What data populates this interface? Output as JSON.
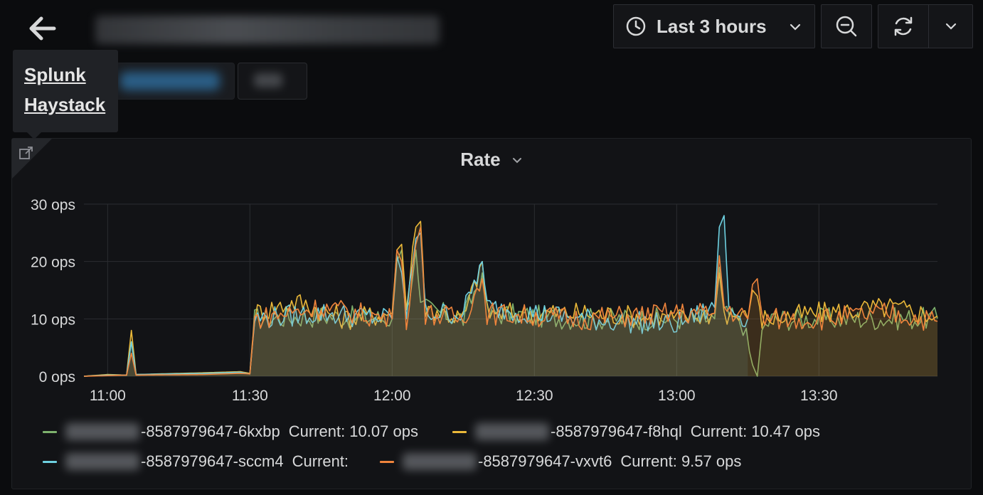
{
  "header": {
    "back_icon": "arrow-left-icon",
    "time_range_label": "Last 3 hours",
    "time_icon": "clock-icon",
    "zoom_icon": "zoom-out-icon",
    "refresh_icon": "refresh-icon",
    "refresh_dropdown_icon": "chevron-down-icon"
  },
  "tooltip": {
    "links": [
      "Splunk",
      "Haystack"
    ]
  },
  "panel": {
    "title": "Rate",
    "link_icon": "external-link-icon"
  },
  "colors": {
    "background": "#0b0c0e",
    "panel": "#121316",
    "grid": "#2b2d31",
    "fill": "#4a4035"
  },
  "chart_data": {
    "type": "line",
    "title": "Rate",
    "yunit": "ops",
    "ylim": [
      0,
      30
    ],
    "yticks": [
      "0 ops",
      "10 ops",
      "20 ops",
      "30 ops"
    ],
    "xticks": [
      "11:00",
      "11:30",
      "12:00",
      "12:30",
      "13:00",
      "13:30"
    ],
    "xrange": [
      "10:55",
      "13:55"
    ],
    "grid": true,
    "fill": true,
    "legend_placement": "bottom",
    "series": [
      {
        "name": "-8587979647-6kxbp",
        "color": "#7eb26d",
        "current": "Current: 10.07 ops",
        "points": [
          [
            "10:55",
            0
          ],
          [
            "11:00",
            0.2
          ],
          [
            "11:04",
            0.2
          ],
          [
            "11:05",
            6
          ],
          [
            "11:06",
            0.3
          ],
          [
            "11:20",
            0.4
          ],
          [
            "11:28",
            0.5
          ],
          [
            "11:30",
            0.5
          ],
          [
            "11:31",
            10
          ],
          [
            "11:45",
            10.5
          ],
          [
            "12:00",
            10
          ],
          [
            "12:01",
            20
          ],
          [
            "12:02",
            22
          ],
          [
            "12:03",
            11
          ],
          [
            "12:05",
            22
          ],
          [
            "12:06",
            12
          ],
          [
            "12:15",
            10
          ],
          [
            "12:19",
            18
          ],
          [
            "12:20",
            11
          ],
          [
            "12:40",
            10
          ],
          [
            "13:00",
            10
          ],
          [
            "13:08",
            10
          ],
          [
            "13:09",
            19
          ],
          [
            "13:10",
            11
          ],
          [
            "13:14",
            9
          ],
          [
            "13:16",
            2
          ],
          [
            "13:17",
            0
          ],
          [
            "13:18",
            8
          ],
          [
            "13:20",
            10
          ],
          [
            "13:40",
            10
          ],
          [
            "13:55",
            10.07
          ]
        ]
      },
      {
        "name": "-8587979647-f8hql",
        "color": "#eab839",
        "current": "Current: 10.47 ops",
        "points": [
          [
            "10:55",
            0
          ],
          [
            "11:00",
            0.3
          ],
          [
            "11:04",
            0.2
          ],
          [
            "11:05",
            8
          ],
          [
            "11:06",
            0.3
          ],
          [
            "11:20",
            0.6
          ],
          [
            "11:28",
            0.8
          ],
          [
            "11:30",
            0.5
          ],
          [
            "11:31",
            11
          ],
          [
            "11:40",
            13
          ],
          [
            "11:50",
            10
          ],
          [
            "12:00",
            11
          ],
          [
            "12:01",
            22
          ],
          [
            "12:02",
            23
          ],
          [
            "12:03",
            12
          ],
          [
            "12:05",
            26
          ],
          [
            "12:06",
            27
          ],
          [
            "12:07",
            12
          ],
          [
            "12:15",
            10
          ],
          [
            "12:19",
            20
          ],
          [
            "12:20",
            11
          ],
          [
            "12:40",
            11
          ],
          [
            "13:00",
            10
          ],
          [
            "13:08",
            11
          ],
          [
            "13:09",
            18
          ],
          [
            "13:10",
            11
          ],
          [
            "13:15",
            10
          ],
          [
            "13:16",
            15
          ],
          [
            "13:17",
            14
          ],
          [
            "13:18",
            10
          ],
          [
            "13:30",
            11
          ],
          [
            "13:45",
            12
          ],
          [
            "13:55",
            10.47
          ]
        ]
      },
      {
        "name": "-8587979647-sccm4",
        "color": "#6ed0e0",
        "current": "Current:",
        "points": [
          [
            "10:55",
            0
          ],
          [
            "11:00",
            0.2
          ],
          [
            "11:04",
            0.2
          ],
          [
            "11:05",
            6
          ],
          [
            "11:06",
            0.3
          ],
          [
            "11:20",
            0.5
          ],
          [
            "11:28",
            0.7
          ],
          [
            "11:30",
            0.4
          ],
          [
            "11:31",
            10
          ],
          [
            "11:45",
            11
          ],
          [
            "12:00",
            10
          ],
          [
            "12:01",
            21
          ],
          [
            "12:02",
            18
          ],
          [
            "12:03",
            11
          ],
          [
            "12:05",
            24
          ],
          [
            "12:06",
            25
          ],
          [
            "12:07",
            11
          ],
          [
            "12:15",
            11
          ],
          [
            "12:19",
            20
          ],
          [
            "12:20",
            12
          ],
          [
            "12:40",
            10
          ],
          [
            "13:00",
            9
          ],
          [
            "13:08",
            12
          ],
          [
            "13:09",
            26
          ],
          [
            "13:10",
            28
          ],
          [
            "13:11",
            12
          ],
          [
            "13:15",
            10
          ]
        ]
      },
      {
        "name": "-8587979647-vxvt6",
        "color": "#ef843c",
        "current": "Current: 9.57 ops",
        "points": [
          [
            "10:55",
            0
          ],
          [
            "11:00",
            0.1
          ],
          [
            "11:04",
            0.2
          ],
          [
            "11:05",
            4
          ],
          [
            "11:06",
            0.2
          ],
          [
            "11:20",
            0.3
          ],
          [
            "11:28",
            0.5
          ],
          [
            "11:30",
            0.4
          ],
          [
            "11:31",
            10
          ],
          [
            "11:45",
            12
          ],
          [
            "12:00",
            10
          ],
          [
            "12:01",
            22
          ],
          [
            "12:02",
            20
          ],
          [
            "12:03",
            10
          ],
          [
            "12:05",
            23
          ],
          [
            "12:06",
            26
          ],
          [
            "12:07",
            11
          ],
          [
            "12:15",
            10
          ],
          [
            "12:19",
            17
          ],
          [
            "12:20",
            11
          ],
          [
            "12:40",
            10
          ],
          [
            "13:00",
            11
          ],
          [
            "13:08",
            11
          ],
          [
            "13:09",
            21
          ],
          [
            "13:10",
            12
          ],
          [
            "13:15",
            10
          ],
          [
            "13:16",
            16
          ],
          [
            "13:17",
            17
          ],
          [
            "13:18",
            10
          ],
          [
            "13:30",
            10
          ],
          [
            "13:45",
            11
          ],
          [
            "13:55",
            9.57
          ]
        ]
      }
    ]
  }
}
